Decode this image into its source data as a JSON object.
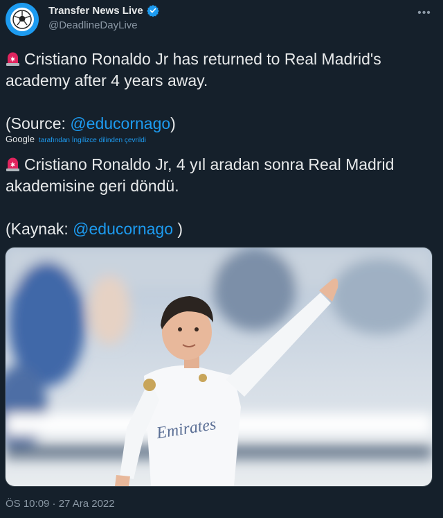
{
  "account": {
    "display_name": "Transfer News Live",
    "handle": "@DeadlineDayLive",
    "verified": true,
    "avatar_icon": "football-icon"
  },
  "tweet": {
    "original": {
      "emoji_icon": "siren-icon",
      "line_text": "Cristiano Ronaldo Jr has returned to Real Madrid's academy after 4 years away.",
      "source_prefix": "(Source: ",
      "source_link": "@educornago",
      "source_suffix": ")"
    },
    "translation": {
      "provider": "Google",
      "note": "tarafından İngilizce dilinden çevrildi",
      "emoji_icon": "siren-icon",
      "line_text": "Cristiano Ronaldo Jr, 4 yıl aradan sonra Real Madrid akademisine geri döndü.",
      "source_prefix": "(Kaynak: ",
      "source_link": "@educornago",
      "source_suffix": " )"
    },
    "media": {
      "jersey_sponsor": "Emirates"
    },
    "timestamp": "ÖS 10:09 · 27 Ara 2022"
  },
  "colors": {
    "background": "#15202b",
    "text": "#e7e9ea",
    "secondary": "#8b98a5",
    "accent": "#1d9bf0"
  }
}
